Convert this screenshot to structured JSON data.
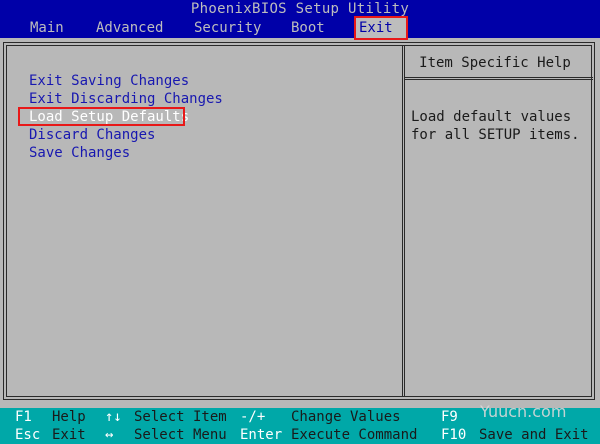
{
  "title": "PhoenixBIOS Setup Utility",
  "menu": [
    {
      "label": "Main"
    },
    {
      "label": "Advanced"
    },
    {
      "label": "Security"
    },
    {
      "label": "Boot"
    },
    {
      "label": "Exit"
    }
  ],
  "active_menu": "Exit",
  "exit_options": [
    {
      "label": "Exit Saving Changes"
    },
    {
      "label": "Exit Discarding Changes"
    },
    {
      "label": "Load Setup Defaults"
    },
    {
      "label": "Discard Changes"
    },
    {
      "label": "Save Changes"
    }
  ],
  "selected_option": "Load Setup Defaults",
  "help": {
    "title": "Item Specific Help",
    "text": "Load default values\nfor all SETUP items."
  },
  "footer": {
    "row1": {
      "f1_key": "F1",
      "f1_label": "Help",
      "arrows_ud_key": "↑↓",
      "arrows_ud_label": "Select Item",
      "pm_key": "-/+",
      "pm_label": "Change Values",
      "f9_key": "F9"
    },
    "row2": {
      "esc_key": "Esc",
      "esc_label": "Exit",
      "arrows_lr_key": "↔",
      "arrows_lr_label": "Select Menu",
      "enter_key": "Enter",
      "enter_label": "Execute Command",
      "f10_key": "F10",
      "f10_label": "Save and Exit"
    }
  },
  "watermark": "Yuucn.com",
  "colors": {
    "bios_blue": "#0000a8",
    "panel_gray": "#b8b8b8",
    "footer_cyan": "#00a8a8",
    "highlight_red": "#e81818"
  }
}
